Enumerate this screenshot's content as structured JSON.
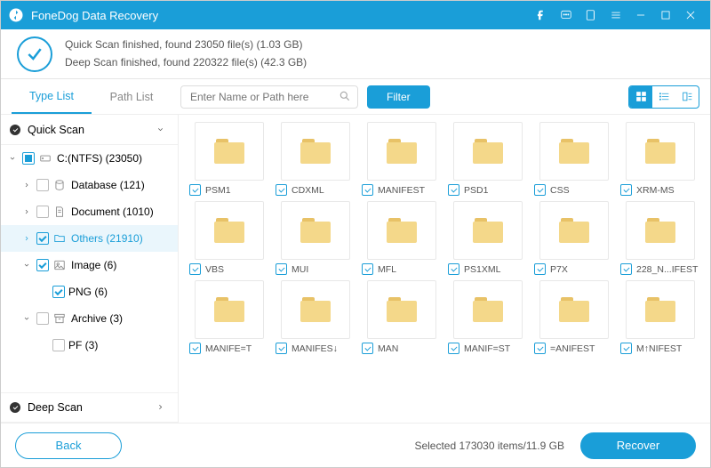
{
  "titlebar": {
    "title": "FoneDog Data Recovery"
  },
  "status": {
    "line1": "Quick Scan finished, found 23050 file(s) (1.03 GB)",
    "line2": "Deep Scan finished, found 220322 file(s) (42.3 GB)"
  },
  "tabs": {
    "type": "Type List",
    "path": "Path List"
  },
  "search": {
    "placeholder": "Enter Name or Path here"
  },
  "filter_label": "Filter",
  "tree": {
    "quickscan": "Quick Scan",
    "deepscan": "Deep Scan",
    "drive": "C:(NTFS) (23050)",
    "database": "Database (121)",
    "document": "Document (1010)",
    "others": "Others (21910)",
    "image": "Image (6)",
    "png": "PNG (6)",
    "archive": "Archive (3)",
    "pf": "PF (3)"
  },
  "files": [
    "PSM1",
    "CDXML",
    "MANIFEST",
    "PSD1",
    "CSS",
    "XRM-MS",
    "VBS",
    "MUI",
    "MFL",
    "PS1XML",
    "P7X",
    "228_N...IFEST",
    "MANIFE=T",
    "MANIFES↓",
    "MAN",
    "MANIF=ST",
    "=ANIFEST",
    "M↑NIFEST"
  ],
  "footer": {
    "back": "Back",
    "recover": "Recover",
    "stats": "Selected 173030 items/11.9 GB"
  }
}
